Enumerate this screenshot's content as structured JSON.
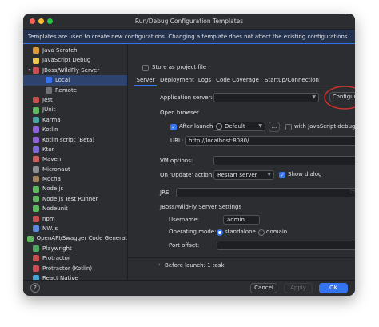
{
  "window": {
    "title": "Run/Debug Configuration Templates",
    "banner": "Templates are used to create new configurations. Changing a template does not affect the existing configurations."
  },
  "sidebar": {
    "items": [
      {
        "label": "Java Scratch",
        "color": "#d99a3e",
        "indent": 1
      },
      {
        "label": "JavaScript Debug",
        "color": "#e9c84a",
        "indent": 1
      },
      {
        "label": "JBoss/WildFly Server",
        "color": "#c94f4f",
        "indent": 1,
        "expanded": true
      },
      {
        "label": "Local",
        "color": "#3574f0",
        "indent": 2,
        "selected": true
      },
      {
        "label": "Remote",
        "color": "#6f737a",
        "indent": 2
      },
      {
        "label": "Jest",
        "color": "#c94f4f",
        "indent": 1
      },
      {
        "label": "JUnit",
        "color": "#5fb85f",
        "indent": 1
      },
      {
        "label": "Karma",
        "color": "#4aa3a3",
        "indent": 1
      },
      {
        "label": "Kotlin",
        "color": "#8f62d8",
        "indent": 1
      },
      {
        "label": "Kotlin script (Beta)",
        "color": "#8f62d8",
        "indent": 1
      },
      {
        "label": "Ktor",
        "color": "#7f6ad8",
        "indent": 1
      },
      {
        "label": "Maven",
        "color": "#c95f5f",
        "indent": 1
      },
      {
        "label": "Micronaut",
        "color": "#8a8d92",
        "indent": 1
      },
      {
        "label": "Mocha",
        "color": "#a7825a",
        "indent": 1
      },
      {
        "label": "Node.js",
        "color": "#5fb85f",
        "indent": 1
      },
      {
        "label": "Node.js Test Runner",
        "color": "#5fb85f",
        "indent": 1
      },
      {
        "label": "Nodeunit",
        "color": "#5fb85f",
        "indent": 1
      },
      {
        "label": "npm",
        "color": "#c94f4f",
        "indent": 1
      },
      {
        "label": "NW.js",
        "color": "#5b8bd8",
        "indent": 1
      },
      {
        "label": "OpenAPI/Swagger Code Generat",
        "color": "#5fb85f",
        "indent": 1
      },
      {
        "label": "Playwright",
        "color": "#4fa85f",
        "indent": 1
      },
      {
        "label": "Protractor",
        "color": "#c94f4f",
        "indent": 1
      },
      {
        "label": "Protractor (Kotlin)",
        "color": "#c94f4f",
        "indent": 1
      },
      {
        "label": "React Native",
        "color": "#4aa3d3",
        "indent": 1
      }
    ]
  },
  "main": {
    "store_as_project_file": "Store as project file",
    "tabs": [
      "Server",
      "Deployment",
      "Logs",
      "Code Coverage",
      "Startup/Connection"
    ],
    "app_server_label": "Application server:",
    "configure_button": "Configure...",
    "open_browser_label": "Open browser",
    "after_launch_label": "After launch",
    "browser_value": "Default",
    "more_button": "...",
    "with_js_debugger": "with JavaScript debugger",
    "url_label": "URL:",
    "url_value": "http://localhost:8080/",
    "vm_options_label": "VM options:",
    "on_update_label": "On 'Update' action:",
    "on_update_value": "Restart server",
    "show_dialog": "Show dialog",
    "jre_label": "JRE:",
    "jboss_settings_label": "JBoss/WildFly Server Settings",
    "username_label": "Username:",
    "username_value": "admin",
    "operating_mode_label": "Operating mode:",
    "mode_standalone": "standalone",
    "mode_domain": "domain",
    "port_offset_label": "Port offset:",
    "before_launch": "Before launch: 1 task"
  },
  "footer": {
    "help": "?",
    "cancel": "Cancel",
    "apply": "Apply",
    "ok": "OK"
  },
  "colors": {
    "accent": "#3574f0",
    "annotation": "#d0312d"
  }
}
